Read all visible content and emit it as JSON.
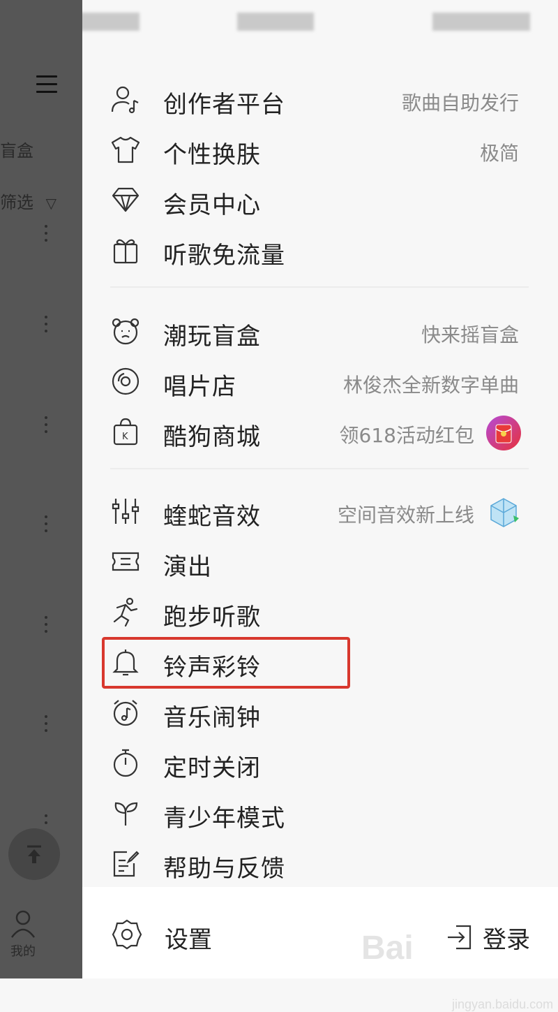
{
  "background_app": {
    "bg_text_1": "盲盒",
    "bg_text_2": "筛选",
    "filter_glyph": "▽",
    "profile_label": "我的"
  },
  "drawer": {
    "group1": [
      {
        "label": "创作者平台",
        "hint": "歌曲自助发行",
        "icon": "creator-icon"
      },
      {
        "label": "个性换肤",
        "hint": "极简",
        "icon": "tshirt-icon"
      },
      {
        "label": "会员中心",
        "hint": "",
        "icon": "diamond-icon"
      },
      {
        "label": "听歌免流量",
        "hint": "",
        "icon": "gift-icon"
      }
    ],
    "group2": [
      {
        "label": "潮玩盲盒",
        "hint": "快来摇盲盒",
        "icon": "bear-icon"
      },
      {
        "label": "唱片店",
        "hint": "林俊杰全新数字单曲",
        "icon": "vinyl-icon"
      },
      {
        "label": "酷狗商城",
        "hint": "领618活动红包",
        "icon": "shopping-bag-icon",
        "badge": "red-envelope-badge"
      }
    ],
    "group3": [
      {
        "label": "蝰蛇音效",
        "hint": "空间音效新上线",
        "icon": "equalizer-icon",
        "badge": "cube-badge"
      },
      {
        "label": "演出",
        "hint": "",
        "icon": "ticket-icon"
      },
      {
        "label": "跑步听歌",
        "hint": "",
        "icon": "runner-icon"
      },
      {
        "label": "铃声彩铃",
        "hint": "",
        "icon": "bell-icon"
      },
      {
        "label": "音乐闹钟",
        "hint": "",
        "icon": "alarm-clock-icon"
      },
      {
        "label": "定时关闭",
        "hint": "",
        "icon": "timer-icon"
      },
      {
        "label": "青少年模式",
        "hint": "",
        "icon": "sprout-icon"
      },
      {
        "label": "帮助与反馈",
        "hint": "",
        "icon": "feedback-icon"
      }
    ],
    "bottom": {
      "settings_label": "设置",
      "login_label": "登录"
    }
  },
  "watermark": {
    "main": "Bai",
    "sub": "jingyan.baidu.com"
  },
  "colors": {
    "highlight": "#d8382e",
    "hint": "#8a8a8a",
    "dim_overlay": "#565656"
  }
}
